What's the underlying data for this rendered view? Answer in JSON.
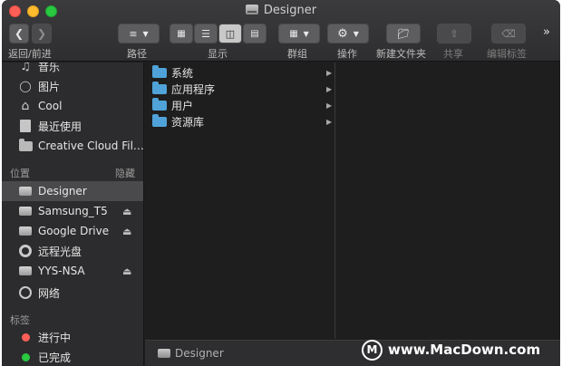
{
  "window": {
    "title": "Designer"
  },
  "toolbar": {
    "back_forward_label": "返回/前进",
    "path_label": "路径",
    "view_label": "显示",
    "group_label": "群组",
    "action_label": "操作",
    "new_folder_label": "新建文件夹",
    "share_label": "共享",
    "edit_tags_label": "编辑标签",
    "more_glyph": "»"
  },
  "sidebar": {
    "favorites": [
      {
        "label": "音乐",
        "icon": "music-icon"
      },
      {
        "label": "图片",
        "icon": "pictures-icon"
      },
      {
        "label": "Cool",
        "icon": "home-icon"
      },
      {
        "label": "最近使用",
        "icon": "recents-icon"
      },
      {
        "label": "Creative Cloud Fil…",
        "icon": "folder-icon"
      }
    ],
    "locations_header": "位置",
    "locations_hide": "隐藏",
    "locations": [
      {
        "label": "Designer",
        "icon": "drive-icon",
        "eject": false,
        "selected": true
      },
      {
        "label": "Samsung_T5",
        "icon": "drive-icon",
        "eject": true,
        "selected": false
      },
      {
        "label": "Google Drive",
        "icon": "drive-icon",
        "eject": true,
        "selected": false
      },
      {
        "label": "远程光盘",
        "icon": "disc-icon",
        "eject": false,
        "selected": false
      },
      {
        "label": "YYS-NSA",
        "icon": "drive-icon",
        "eject": true,
        "selected": false
      },
      {
        "label": "网络",
        "icon": "network-icon",
        "eject": false,
        "selected": false
      }
    ],
    "tags_header": "标签",
    "tags": [
      {
        "label": "进行中",
        "color": "#fd5f57"
      },
      {
        "label": "已完成",
        "color": "#28c840"
      }
    ]
  },
  "column1": {
    "items": [
      {
        "label": "系统"
      },
      {
        "label": "应用程序"
      },
      {
        "label": "用户"
      },
      {
        "label": "资源库"
      }
    ]
  },
  "pathbar": {
    "label": "Designer"
  },
  "watermark": {
    "logo_glyph": "M",
    "text": "www.MacDown.com"
  },
  "colors": {
    "accent_folder": "#4fa3d9",
    "selected_row": "#4a4a4c"
  }
}
